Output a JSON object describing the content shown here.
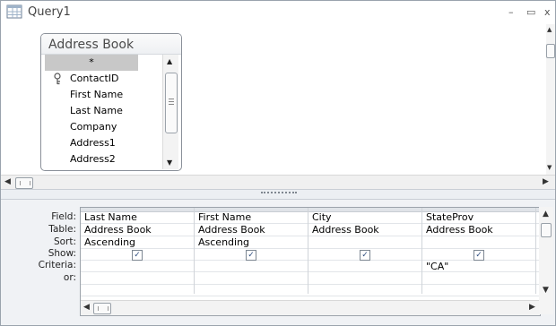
{
  "window": {
    "title": "Query1",
    "minimize_glyph": "–",
    "restore_glyph": "▭",
    "close_glyph": "x"
  },
  "table_box": {
    "title": "Address Book",
    "fields": [
      "*",
      "ContactID",
      "First Name",
      "Last Name",
      "Company",
      "Address1",
      "Address2"
    ],
    "primary_key_field": "ContactID",
    "selected_field": "*"
  },
  "design_grid": {
    "row_labels": [
      "Field:",
      "Table:",
      "Sort:",
      "Show:",
      "Criteria:",
      "or:"
    ],
    "columns": [
      {
        "field": "Last Name",
        "table": "Address Book",
        "sort": "Ascending",
        "show": true,
        "criteria": "",
        "or": ""
      },
      {
        "field": "First Name",
        "table": "Address Book",
        "sort": "Ascending",
        "show": true,
        "criteria": "",
        "or": ""
      },
      {
        "field": "City",
        "table": "Address Book",
        "sort": "",
        "show": true,
        "criteria": "",
        "or": ""
      },
      {
        "field": "StateProv",
        "table": "Address Book",
        "sort": "",
        "show": true,
        "criteria": "\"CA\"",
        "or": ""
      }
    ]
  },
  "glyphs": {
    "check": "✓",
    "up": "▲",
    "down": "▼",
    "left": "◀",
    "right": "▶",
    "key": "🔑"
  }
}
